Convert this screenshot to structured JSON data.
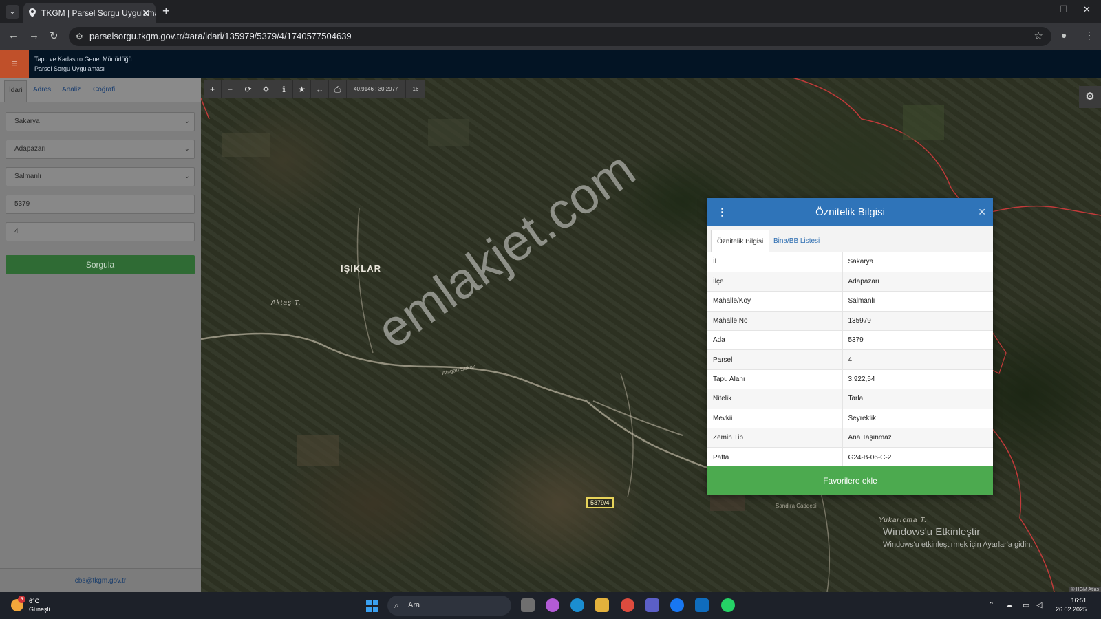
{
  "browser": {
    "tab_title": "TKGM | Parsel Sorgu Uygulaması",
    "url": "parselsorgu.tkgm.gov.tr/#ara/idari/135979/5379/4/1740577504639"
  },
  "header": {
    "org_line1": "Tapu ve Kadastro Genel Müdürlüğü",
    "org_line2": "Parsel Sorgu Uygulaması"
  },
  "sidebar": {
    "tabs": [
      "İdari",
      "Adres",
      "Analiz",
      "Coğrafi"
    ],
    "il": "Sakarya",
    "ilce": "Adapazarı",
    "mahalle": "Salmanlı",
    "ada": "5379",
    "parsel": "4",
    "button": "Sorgula",
    "footer_email": "cbs@tkgm.gov.tr"
  },
  "map": {
    "coords": "40.9146 : 30.2977",
    "zoom": "16",
    "place_main": "IŞIKLAR",
    "place_aktas": "Aktaş T.",
    "place_yukari": "Yukarıçma T.",
    "parcel_label": "5379/4",
    "road1": "Atılgan Sokak",
    "road2": "Sandıra Caddesi",
    "watermark": "emlakjet.com",
    "activate_title": "Windows'u Etkinleştir",
    "activate_sub": "Windows'u etkinleştirmek için Ayarlar'a gidin.",
    "attribution": "© HGM Atlas"
  },
  "popup": {
    "title": "Öznitelik Bilgisi",
    "tab_active": "Öznitelik Bilgisi",
    "tab_other": "Bina/BB Listesi",
    "rows": [
      {
        "k": "İl",
        "v": "Sakarya"
      },
      {
        "k": "İlçe",
        "v": "Adapazarı"
      },
      {
        "k": "Mahalle/Köy",
        "v": "Salmanlı"
      },
      {
        "k": "Mahalle No",
        "v": "135979"
      },
      {
        "k": "Ada",
        "v": "5379"
      },
      {
        "k": "Parsel",
        "v": "4"
      },
      {
        "k": "Tapu Alanı",
        "v": "3.922,54"
      },
      {
        "k": "Nitelik",
        "v": "Tarla"
      },
      {
        "k": "Mevkii",
        "v": "Seyreklik"
      },
      {
        "k": "Zemin Tip",
        "v": "Ana Taşınmaz"
      },
      {
        "k": "Pafta",
        "v": "G24-B-06-C-2"
      }
    ],
    "button": "Favorilere ekle"
  },
  "taskbar": {
    "temp": "6°C",
    "condition": "Güneşli",
    "weather_badge": "9",
    "search_label": "Ara",
    "time": "16:51",
    "date": "26.02.2025"
  },
  "colors": {
    "popup_header": "#2f74b9",
    "button_green": "#4caa4f",
    "hamburger": "#c0502a"
  }
}
